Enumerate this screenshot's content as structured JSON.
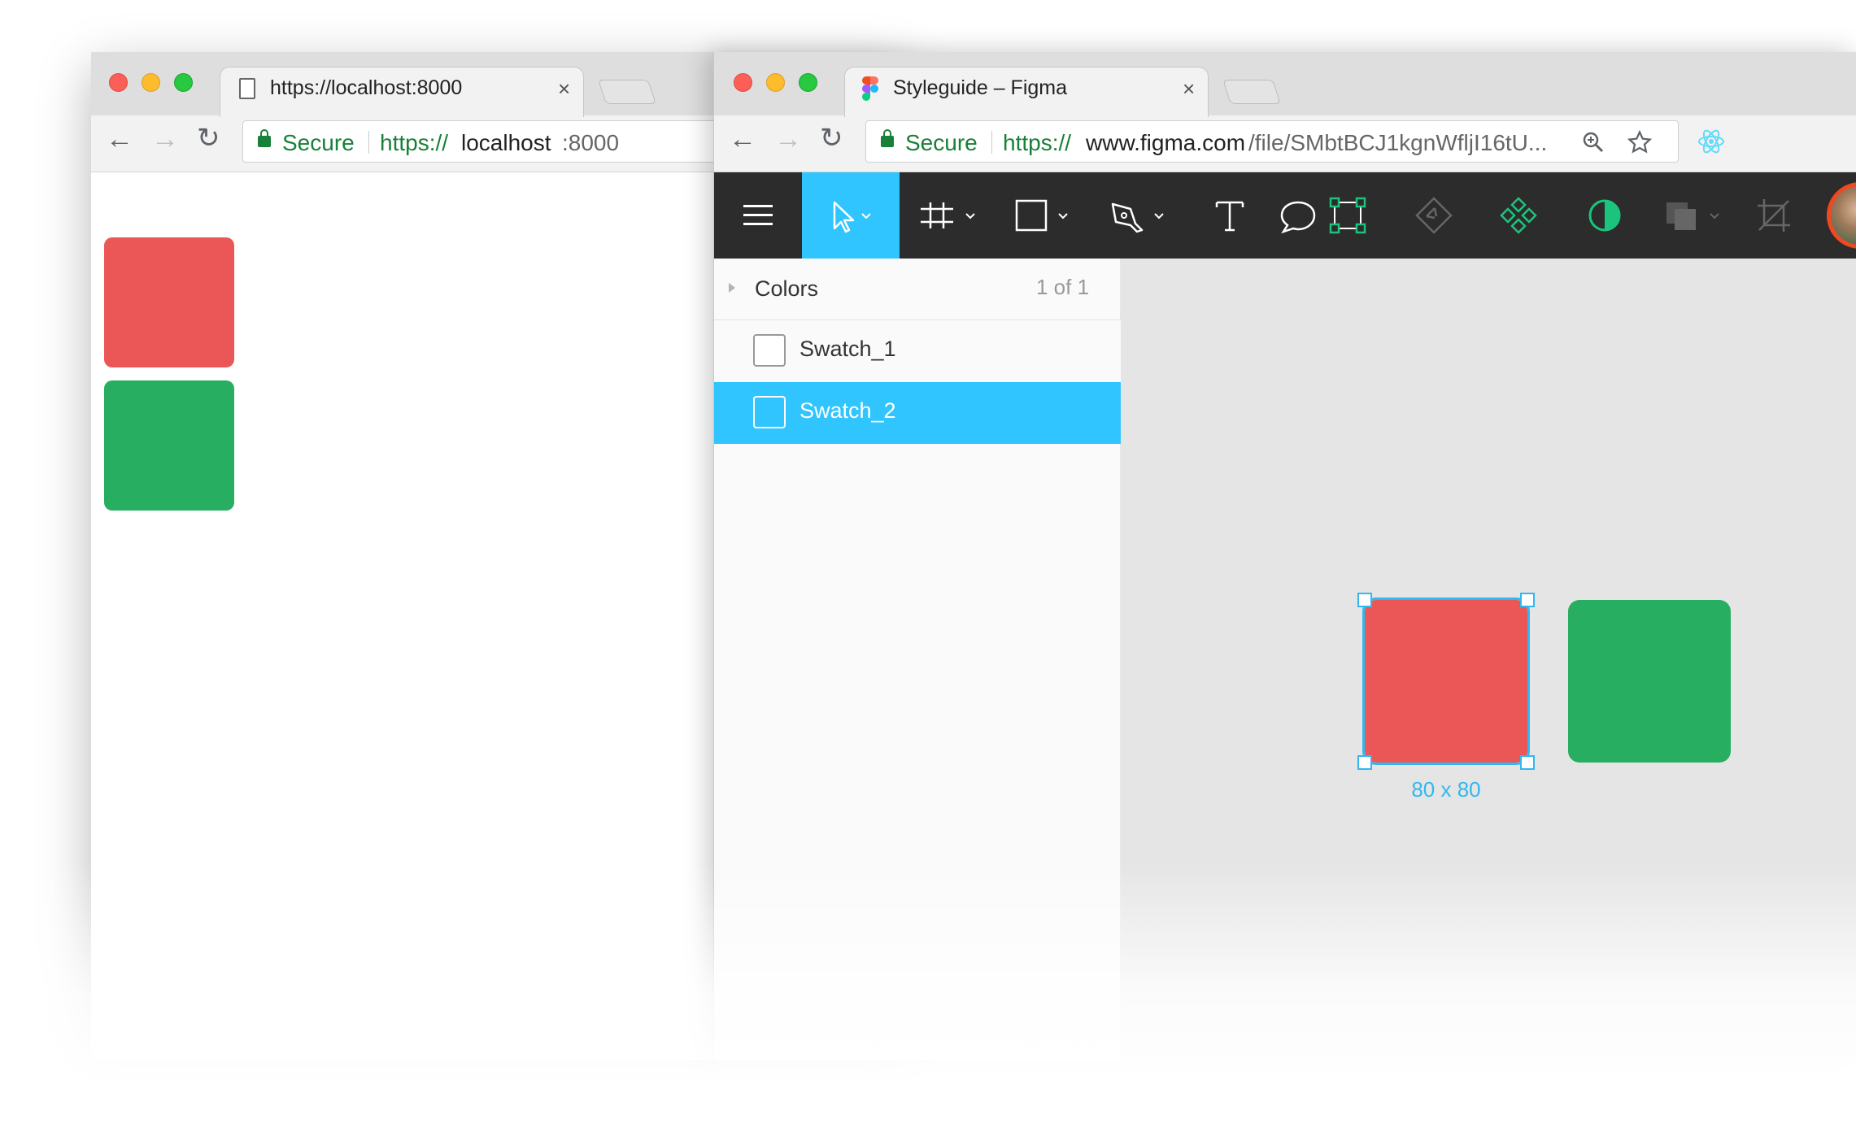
{
  "left_window": {
    "tab_title": "https://localhost:8000",
    "omnibox": {
      "secure_label": "Secure",
      "url_scheme": "https://",
      "url_host": "localhost",
      "url_rest": ":8000"
    },
    "swatches": [
      {
        "name": "red",
        "color": "#eb5757"
      },
      {
        "name": "green",
        "color": "#27ae60"
      }
    ]
  },
  "right_window": {
    "tab_title": "Styleguide – Figma",
    "omnibox": {
      "secure_label": "Secure",
      "url_scheme": "https://",
      "url_host": "www.figma.com",
      "url_rest": "/file/SMbtBCJ1kgnWfljI16tU..."
    },
    "toolbar": {
      "tools": [
        "menu-icon",
        "move-tool-icon",
        "frame-tool-icon",
        "rectangle-tool-icon",
        "pen-tool-icon",
        "text-tool-icon",
        "comment-icon",
        "component-icon",
        "instance-icon",
        "component-set-icon",
        "mask-icon",
        "boolean-icon",
        "crop-icon"
      ],
      "active_tool": "move-tool-icon",
      "active_color": "#30c5ff"
    },
    "layers": {
      "page_name": "Colors",
      "page_count": "1 of 1",
      "items": [
        {
          "label": "Swatch_1",
          "selected": false
        },
        {
          "label": "Swatch_2",
          "selected": true
        }
      ]
    },
    "canvas": {
      "selected_shape": {
        "color": "#eb5757",
        "dimension_label": "80 x 80"
      },
      "other_shape": {
        "color": "#27ae60"
      }
    }
  },
  "colors": {
    "accent": "#30c5ff",
    "secure_green": "#188038",
    "red": "#eb5757",
    "green": "#27ae60",
    "toolbar_bg": "#2c2c2c"
  }
}
